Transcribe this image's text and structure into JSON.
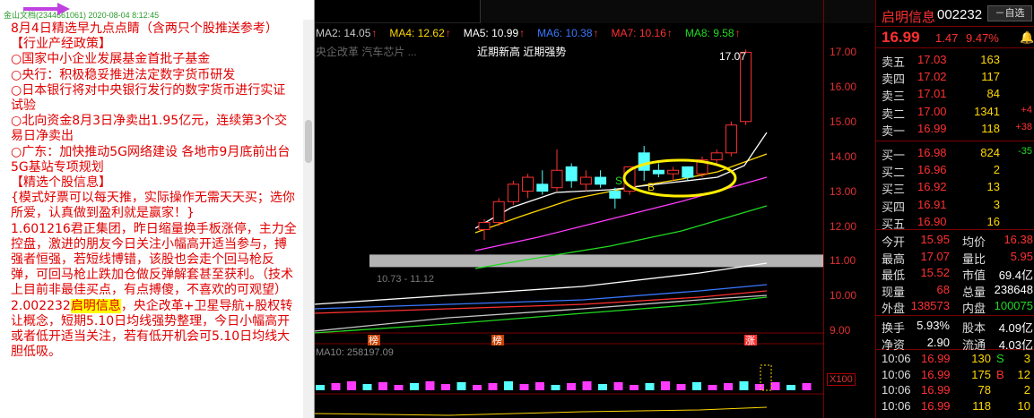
{
  "note": {
    "header": "金山文档(2344661061) 2020-08-04 8:12:45",
    "paragraphs": [
      "8月4日精选早九点点睛（含两只个股推送参考）",
      "【行业产经政策】",
      "○国家中小企业发展基金首批子基金",
      "○央行：积极稳妥推进法定数字货币研发",
      "○日本银行将对中央银行发行的数字货币进行实证试验",
      "○北向资金8月3日净卖出1.95亿元，连续第3个交易日净卖出",
      "○广东：加快推动5G网络建设 各地市9月底前出台5G基站专项规划",
      "【精选个股信息】",
      "{模式好票可以每天推，实际操作无需天天买；选你所爱，认真做到盈利就是赢家！}",
      "1.601216君正集团，昨日缩量换手板涨停，主力全控盘，激进的朋友今日关注小幅高开适当参与，搏强者恒强，若短线博错，该股也会走个回马枪反弹，可回马枪止跌加仓做反弹解套甚至获利。（技术上目前非最佳买点，有点搏傻，不喜欢的可观望）"
    ],
    "last_prefix": "2.002232",
    "last_highlight": "启明信息",
    "last_rest": "，央企改革+卫星导航+股权转让概念，短期5.10日均线强势整理，今日小幅高开或者低开适当关注，若有低开机会可5.10日均线大胆低吸。"
  },
  "chart": {
    "ma_legend": [
      {
        "label": "MA2: 14.05",
        "color": "#c8c8c8"
      },
      {
        "label": "MA4: 12.62",
        "color": "#ffd800"
      },
      {
        "label": "MA5: 10.99",
        "color": "#ffffff"
      },
      {
        "label": "MA6: 10.38",
        "color": "#3a78ff"
      },
      {
        "label": "MA7: 10.16",
        "color": "#ff3030"
      },
      {
        "label": "MA8: 9.58",
        "color": "#21d921"
      }
    ],
    "concept_faint": "央企改革 汽车芯片 ...",
    "concept_tags": "近期新高 近期强势",
    "price_ticks": [
      "17.00",
      "16.00",
      "15.00",
      "14.00",
      "13.00",
      "12.00",
      "11.00",
      "10.00",
      "9.00"
    ],
    "high_label": "17.07",
    "range_label": "10.73 - 11.12",
    "ma10_label": "MA10: 258197.09",
    "x100_label": "X100",
    "s_marker": "S",
    "b_marker": "B",
    "event_marks": [
      "榜",
      "榜",
      "涨"
    ]
  },
  "chart_data": {
    "type": "candlestick",
    "series": [
      {
        "o": 11.9,
        "h": 12.2,
        "l": 11.6,
        "c": 12.1
      },
      {
        "o": 12.1,
        "h": 12.8,
        "l": 12.0,
        "c": 12.7
      },
      {
        "o": 12.7,
        "h": 13.3,
        "l": 12.6,
        "c": 13.2
      },
      {
        "o": 13.0,
        "h": 13.5,
        "l": 12.8,
        "c": 13.4
      },
      {
        "o": 13.2,
        "h": 13.6,
        "l": 12.9,
        "c": 13.0
      },
      {
        "o": 13.1,
        "h": 14.2,
        "l": 13.0,
        "c": 13.6
      },
      {
        "o": 13.7,
        "h": 13.8,
        "l": 13.1,
        "c": 13.3
      },
      {
        "o": 13.2,
        "h": 13.6,
        "l": 13.0,
        "c": 13.4
      },
      {
        "o": 13.4,
        "h": 13.6,
        "l": 13.1,
        "c": 13.2
      },
      {
        "o": 13.0,
        "h": 13.1,
        "l": 12.5,
        "c": 12.8
      },
      {
        "o": 13.0,
        "h": 13.7,
        "l": 12.9,
        "c": 13.7
      },
      {
        "o": 14.1,
        "h": 14.3,
        "l": 13.3,
        "c": 13.6
      },
      {
        "o": 13.6,
        "h": 13.8,
        "l": 13.4,
        "c": 13.5
      },
      {
        "o": 13.5,
        "h": 13.7,
        "l": 13.3,
        "c": 13.6
      },
      {
        "o": 13.7,
        "h": 13.7,
        "l": 13.3,
        "c": 13.4
      },
      {
        "o": 13.5,
        "h": 14.0,
        "l": 13.4,
        "c": 13.9
      },
      {
        "o": 13.9,
        "h": 14.2,
        "l": 13.8,
        "c": 14.1
      },
      {
        "o": 14.1,
        "h": 15.0,
        "l": 14.0,
        "c": 14.9
      },
      {
        "o": 15.0,
        "h": 17.07,
        "l": 14.9,
        "c": 16.99
      }
    ]
  },
  "quote": {
    "name": "启明信息",
    "code": "002232",
    "btn": "自选",
    "price": "16.99",
    "change": "1.47",
    "pct": "9.47%",
    "sells": [
      {
        "label": "卖五",
        "price": "17.03",
        "vol": "163",
        "delta": ""
      },
      {
        "label": "卖四",
        "price": "17.02",
        "vol": "117",
        "delta": ""
      },
      {
        "label": "卖三",
        "price": "17.01",
        "vol": "84",
        "delta": ""
      },
      {
        "label": "卖二",
        "price": "17.00",
        "vol": "1341",
        "delta": "+4"
      },
      {
        "label": "卖一",
        "price": "16.99",
        "vol": "118",
        "delta": "+38"
      }
    ],
    "buys": [
      {
        "label": "买一",
        "price": "16.98",
        "vol": "824",
        "delta": "-35"
      },
      {
        "label": "买二",
        "price": "16.96",
        "vol": "2",
        "delta": ""
      },
      {
        "label": "买三",
        "price": "16.92",
        "vol": "13",
        "delta": ""
      },
      {
        "label": "买四",
        "price": "16.91",
        "vol": "3",
        "delta": ""
      },
      {
        "label": "买五",
        "price": "16.90",
        "vol": "16",
        "delta": ""
      }
    ],
    "stats": [
      {
        "k1": "今开",
        "v1": "15.95",
        "c1": "red",
        "k2": "均价",
        "v2": "16.38",
        "c2": "red"
      },
      {
        "k1": "最高",
        "v1": "17.07",
        "c1": "red",
        "k2": "量比",
        "v2": "5.95",
        "c2": "red"
      },
      {
        "k1": "最低",
        "v1": "15.52",
        "c1": "red",
        "k2": "市值",
        "v2": "69.4亿",
        "c2": "white"
      },
      {
        "k1": "现量",
        "v1": "68",
        "c1": "red",
        "k2": "总量",
        "v2": "238648",
        "c2": "white"
      },
      {
        "k1": "外盘",
        "v1": "138573",
        "c1": "red",
        "k2": "内盘",
        "v2": "100075",
        "c2": "green"
      }
    ],
    "stats2": [
      {
        "k1": "换手",
        "v1": "5.93%",
        "c1": "white",
        "k2": "股本",
        "v2": "4.09亿",
        "c2": "white"
      },
      {
        "k1": "净资",
        "v1": "2.90",
        "c1": "white",
        "k2": "流通",
        "v2": "4.03亿",
        "c2": "white"
      }
    ],
    "ticks": [
      {
        "t": "10:06",
        "p": "16.99",
        "v": "130",
        "d": "S",
        "dc": "green",
        "n": "3"
      },
      {
        "t": "10:06",
        "p": "16.99",
        "v": "175",
        "d": "B",
        "dc": "red",
        "n": "12"
      },
      {
        "t": "10:06",
        "p": "16.99",
        "v": "78",
        "d": "",
        "dc": "red",
        "n": "2"
      },
      {
        "t": "10:06",
        "p": "16.99",
        "v": "118",
        "d": "",
        "dc": "red",
        "n": "10"
      }
    ]
  }
}
